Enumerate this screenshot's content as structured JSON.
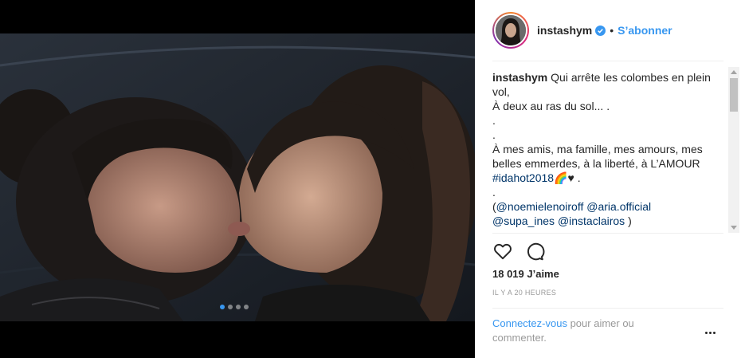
{
  "post": {
    "username": "instashym",
    "separator": "•",
    "follow_label": "S’abonner",
    "carousel": {
      "count": 4,
      "active_index": 0
    }
  },
  "caption": {
    "username": "instashym",
    "line1": "Qui arrête les colombes en plein vol,",
    "line2": "À deux au ras du sol... .",
    "line3": ".",
    "line4": ".",
    "line5": "À mes amis, ma famille, mes amours, mes belles emmerdes, à la liberté, à L’AMOUR",
    "hashtag": "#idahot2018",
    "hashtag_suffix": "🌈♥ .",
    "line7": ".",
    "mentions_open": "(",
    "mention1": "@noemielenoiroff",
    "mention2": "@aria.official",
    "mention3": "@supa_ines",
    "mention4": "@instaclairos",
    "mentions_close": ")"
  },
  "stats": {
    "likes": "18 019 J’aime",
    "time": "IL Y A 20 HEURES"
  },
  "footer": {
    "login_link": "Connectez-vous",
    "login_rest": "pour aimer ou commenter."
  },
  "colors": {
    "accent": "#3897f0",
    "link": "#003569",
    "muted": "#999999",
    "text": "#262626"
  },
  "icons": {
    "like": "heart-icon",
    "comment": "comment-bubble-icon",
    "verified": "verified-badge-icon",
    "more": "more-options-icon"
  }
}
